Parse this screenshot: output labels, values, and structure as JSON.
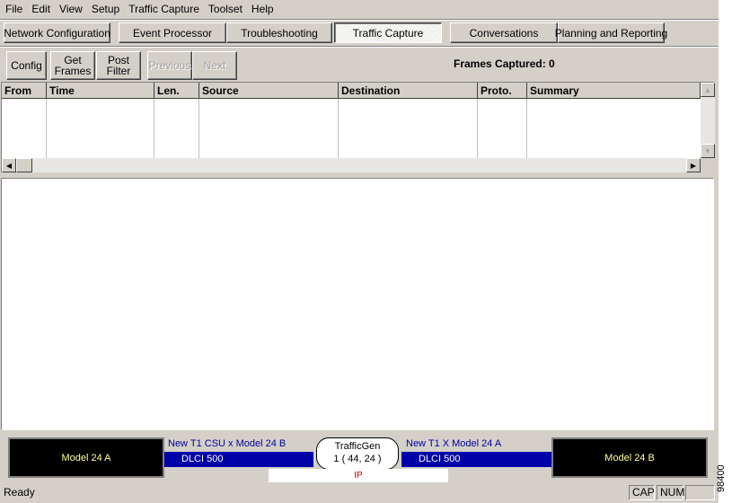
{
  "menu": [
    "File",
    "Edit",
    "View",
    "Setup",
    "Traffic Capture",
    "Toolset",
    "Help"
  ],
  "tabs": [
    {
      "label": "Network Configuration",
      "active": false
    },
    {
      "label": "Event Processor",
      "active": false
    },
    {
      "label": "Troubleshooting",
      "active": false
    },
    {
      "label": "Traffic Capture",
      "active": true
    },
    {
      "label": "Conversations",
      "active": false
    },
    {
      "label": "Planning and Reporting",
      "active": false
    }
  ],
  "toolbar": {
    "config": "Config",
    "get_frames": "Get Frames",
    "post_filter": "Post Filter",
    "previous": "Previous",
    "next": "Next",
    "frames_captured_label": "Frames Captured:",
    "frames_captured_value": "0"
  },
  "packet_table": {
    "columns": [
      "From",
      "Time",
      "Len.",
      "Source",
      "Destination",
      "Proto.",
      "Summary"
    ],
    "rows": []
  },
  "topology": {
    "left_device": "Model 24 A",
    "left_link": "New T1 CSU x Model 24 B",
    "left_dlci": "DLCI 500",
    "cloud_line1": "TrafficGen",
    "cloud_line2": "1 ( 44, 24 )",
    "right_link": "New T1 X Model 24 A",
    "right_dlci": "DLCI 500",
    "right_device": "Model 24 B",
    "protocol": "IP"
  },
  "status": {
    "text": "Ready",
    "cap": "CAP",
    "num": "NUM",
    "scroll": ""
  },
  "figure_number": "98400",
  "colors": {
    "face": "#d4d0c8",
    "device_bg": "#000000",
    "device_text": "#ffff99",
    "dlci_bg": "#0000a8",
    "link_text": "#0000a0",
    "protocol_text": "#c00000"
  }
}
